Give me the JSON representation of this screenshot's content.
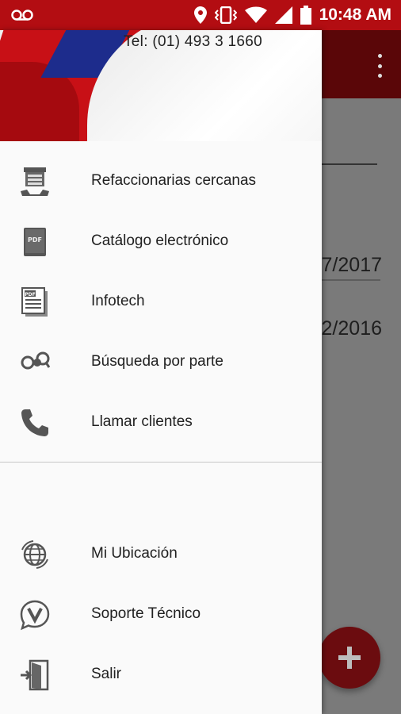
{
  "status_bar": {
    "time": "10:48 AM",
    "icons": [
      "voicemail-icon",
      "location-icon",
      "vibrate-icon",
      "wifi-icon",
      "signal-icon",
      "battery-icon"
    ]
  },
  "background_app": {
    "dates": [
      "7/2017",
      "2/2016"
    ],
    "accent": "#c81016"
  },
  "drawer": {
    "header": {
      "tel": "Tel: (01) 493 3 1660"
    },
    "items": [
      {
        "label": "Refaccionarias cercanas",
        "icon": "store-icon"
      },
      {
        "label": "Catálogo electrónico",
        "icon": "pdf-book-icon"
      },
      {
        "label": "Infotech",
        "icon": "pdf-document-icon"
      },
      {
        "label": "Búsqueda por parte",
        "icon": "part-search-icon"
      },
      {
        "label": "Llamar clientes",
        "icon": "phone-icon"
      }
    ],
    "secondary_items": [
      {
        "label": "Mi Ubicación",
        "icon": "globe-icon"
      },
      {
        "label": "Soporte Técnico",
        "icon": "support-chat-icon"
      },
      {
        "label": "Salir",
        "icon": "exit-door-icon"
      }
    ]
  },
  "colors": {
    "primary": "#b30d12",
    "drawer_bg": "#fafafa",
    "text": "#212121",
    "icon": "#555555"
  }
}
